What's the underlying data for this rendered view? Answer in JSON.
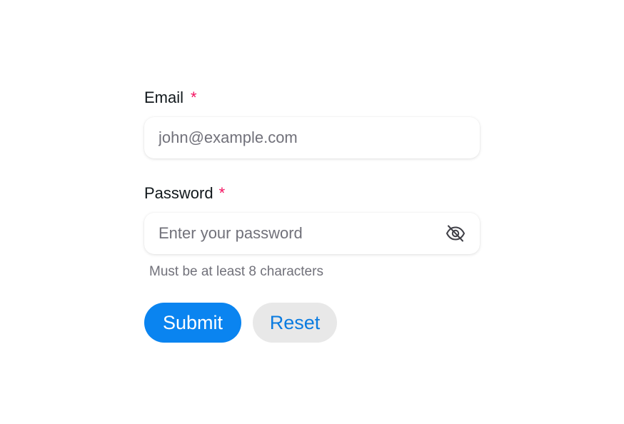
{
  "form": {
    "email": {
      "label": "Email",
      "required_mark": "*",
      "value": "",
      "placeholder": "john@example.com"
    },
    "password": {
      "label": "Password",
      "required_mark": "*",
      "value": "",
      "placeholder": "Enter your password",
      "visibility_icon": "eye-off-icon",
      "helper": "Must be at least 8 characters"
    },
    "submit_label": "Submit",
    "reset_label": "Reset"
  },
  "colors": {
    "primary": "#0a84f0",
    "required": "#f31260",
    "secondary_bg": "#e8e8e8"
  }
}
